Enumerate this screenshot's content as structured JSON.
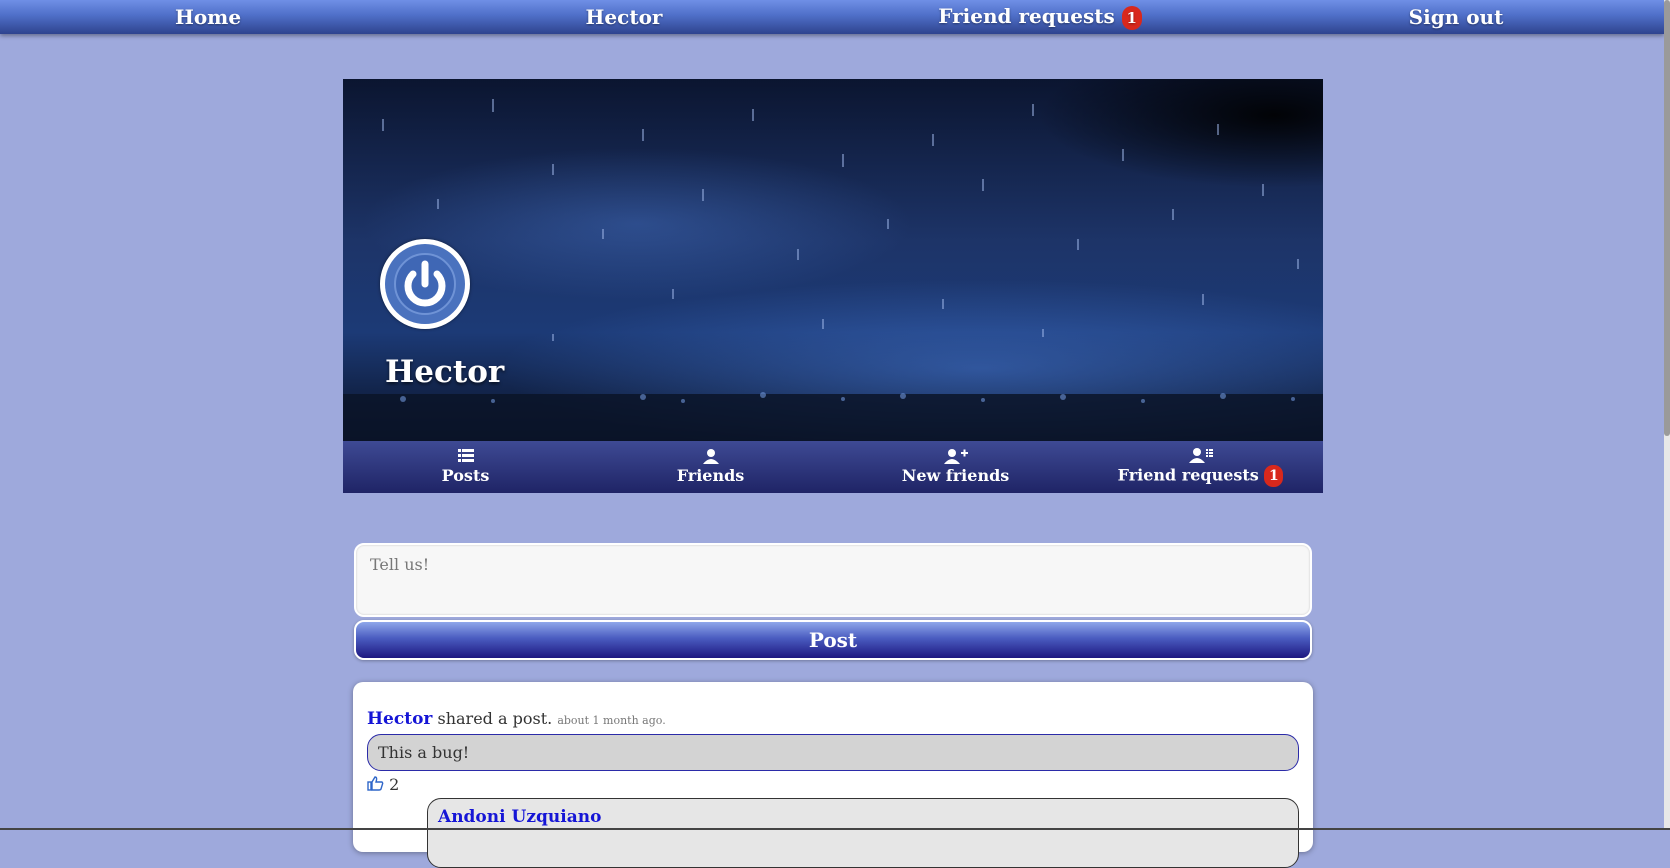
{
  "topnav": {
    "home": "Home",
    "user": "Hector",
    "friend_requests": "Friend requests",
    "friend_requests_count": "1",
    "sign_out": "Sign out"
  },
  "profile": {
    "name": "Hector",
    "tabs": {
      "posts": "Posts",
      "friends": "Friends",
      "new_friends": "New friends",
      "friend_requests": "Friend requests",
      "friend_requests_count": "1"
    }
  },
  "composer": {
    "placeholder": "Tell us!",
    "value": "",
    "post_label": "Post"
  },
  "feed": {
    "post": {
      "author": "Hector",
      "action": "shared a post.",
      "time": "about 1 month ago.",
      "body": "This a bug!",
      "likes": "2",
      "comment": {
        "author": "Andoni Uzquiano"
      }
    }
  },
  "colors": {
    "page_bg": "#9ea9dc",
    "badge": "#d8281c",
    "link": "#1515d6"
  },
  "icons": {
    "posts_tab": "list-icon",
    "friends_tab": "user-icon",
    "new_friends_tab": "user-plus-icon",
    "friend_requests_tab": "user-list-icon",
    "like": "thumbs-up-icon",
    "avatar": "power-icon"
  }
}
